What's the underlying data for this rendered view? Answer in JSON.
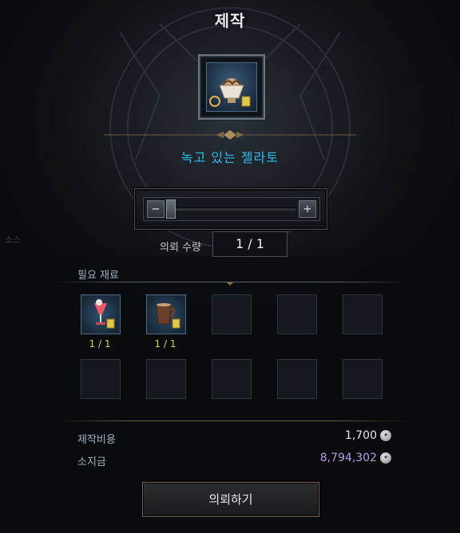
{
  "window": {
    "title": "제작"
  },
  "item": {
    "name": "녹고 있는 젤라토",
    "icon": "gelato-icon"
  },
  "quantity": {
    "label": "의뢰 수량",
    "value": "1 / 1",
    "minus": "−",
    "plus": "+"
  },
  "materials": {
    "label": "필요 재료",
    "slots": [
      {
        "icon": "cocktail-icon",
        "count": "1 / 1"
      },
      {
        "icon": "coffee-cup-icon",
        "count": "1 / 1"
      },
      {
        "icon": "",
        "count": ""
      },
      {
        "icon": "",
        "count": ""
      },
      {
        "icon": "",
        "count": ""
      },
      {
        "icon": "",
        "count": ""
      },
      {
        "icon": "",
        "count": ""
      },
      {
        "icon": "",
        "count": ""
      },
      {
        "icon": "",
        "count": ""
      },
      {
        "icon": "",
        "count": ""
      }
    ]
  },
  "cost": {
    "craft_label": "제작비용",
    "craft_value": "1,700",
    "owned_label": "소지금",
    "owned_value": "8,794,302"
  },
  "actions": {
    "request_label": "의뢰하기"
  },
  "side_hint": "소스",
  "colors": {
    "item_name": "#2fb8f0",
    "count_ok": "#b9e03a",
    "owned_value": "#b99be8",
    "gold_accent": "#7c6a48"
  }
}
